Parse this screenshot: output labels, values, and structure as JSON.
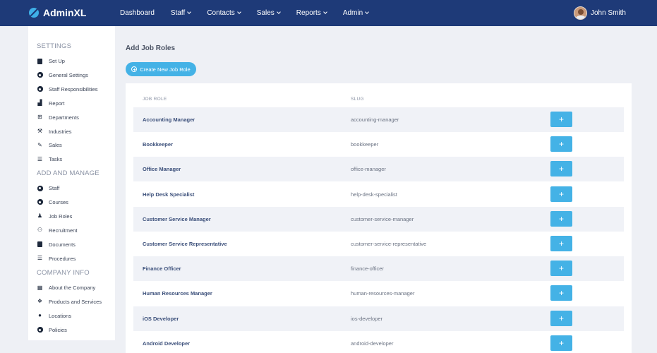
{
  "app": {
    "brand": "AdminXL",
    "user_name": "John Smith"
  },
  "nav": {
    "items": [
      {
        "label": "Dashboard",
        "has_dropdown": false
      },
      {
        "label": "Staff",
        "has_dropdown": true
      },
      {
        "label": "Contacts",
        "has_dropdown": true
      },
      {
        "label": "Sales",
        "has_dropdown": true
      },
      {
        "label": "Reports",
        "has_dropdown": true
      },
      {
        "label": "Admin",
        "has_dropdown": true
      }
    ]
  },
  "sidebar": {
    "sections": [
      {
        "title": "SETTINGS",
        "items": [
          {
            "label": "Set Up",
            "icon": "door-icon"
          },
          {
            "label": "General Settings",
            "icon": "gear-icon"
          },
          {
            "label": "Staff Responsibilities",
            "icon": "gear-icon"
          },
          {
            "label": "Report",
            "icon": "bar-chart-icon"
          },
          {
            "label": "Departments",
            "icon": "sitemap-icon"
          },
          {
            "label": "Industries",
            "icon": "industry-icon"
          },
          {
            "label": "Sales",
            "icon": "handshake-icon"
          },
          {
            "label": "Tasks",
            "icon": "list-icon"
          }
        ]
      },
      {
        "title": "ADD AND MANAGE",
        "items": [
          {
            "label": "Staff",
            "icon": "gear-icon"
          },
          {
            "label": "Courses",
            "icon": "gear-icon"
          },
          {
            "label": "Job Roles",
            "icon": "user-tie-icon"
          },
          {
            "label": "Recruitment",
            "icon": "users-icon"
          },
          {
            "label": "Documents",
            "icon": "document-icon"
          },
          {
            "label": "Procedures",
            "icon": "list-icon"
          }
        ]
      },
      {
        "title": "COMPANY INFO",
        "items": [
          {
            "label": "About the Company",
            "icon": "building-icon"
          },
          {
            "label": "Products and Services",
            "icon": "boxes-icon"
          },
          {
            "label": "Locations",
            "icon": "map-pin-icon"
          },
          {
            "label": "Policies",
            "icon": "gear-icon"
          }
        ]
      }
    ]
  },
  "main": {
    "title": "Add Job Roles",
    "create_button": "Create New Job Role",
    "table": {
      "headers": [
        "JOB ROLE",
        "SLUG"
      ],
      "add_label": "+",
      "rows": [
        {
          "role": "Accounting Manager",
          "slug": "accounting-manager"
        },
        {
          "role": "Bookkeeper",
          "slug": "bookkeeper"
        },
        {
          "role": "Office Manager",
          "slug": "office-manager"
        },
        {
          "role": "Help Desk Specialist",
          "slug": "help-desk-specialist"
        },
        {
          "role": "Customer Service Manager",
          "slug": "customer-service-manager"
        },
        {
          "role": "Customer Service Representative",
          "slug": "customer-service-representative"
        },
        {
          "role": "Finance Officer",
          "slug": "finance-officer"
        },
        {
          "role": "Human Resources Manager",
          "slug": "human-resources-manager"
        },
        {
          "role": "iOS Developer",
          "slug": "ios-developer"
        },
        {
          "role": "Android Developer",
          "slug": "android-developer"
        }
      ]
    }
  },
  "colors": {
    "topbar": "#1e3a78",
    "accent": "#44b2e6",
    "row_alt": "#f0f2f7"
  }
}
